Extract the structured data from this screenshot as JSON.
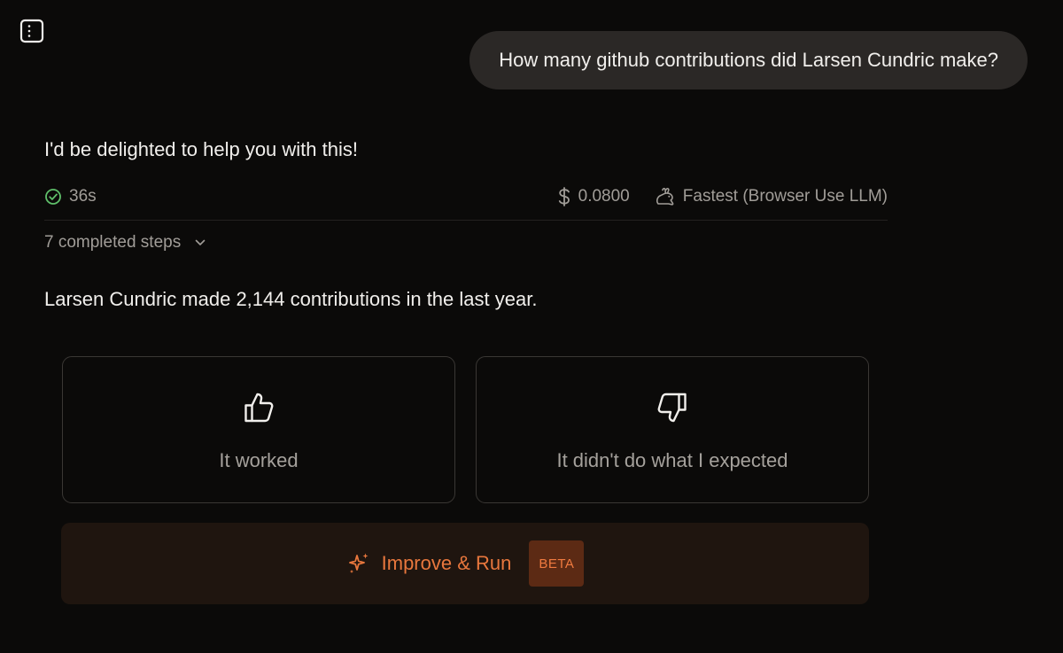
{
  "user_message": "How many github contributions did Larsen Cundric make?",
  "assistant": {
    "intro": "I'd be delighted to help you with this!",
    "duration": "36s",
    "cost": "0.0800",
    "model": "Fastest (Browser Use LLM)",
    "steps_label": "7 completed steps",
    "answer": "Larsen Cundric made 2,144 contributions in the last year."
  },
  "feedback": {
    "positive_label": "It worked",
    "negative_label": "It didn't do what I expected"
  },
  "improve": {
    "label": "Improve & Run",
    "badge": "BETA"
  },
  "icons": {
    "sidebar_toggle": "sidebar-icon",
    "status": "check-circle-icon",
    "cost": "dollar-icon",
    "model": "rabbit-icon",
    "steps": "chevron-down-icon",
    "positive": "thumbs-up-icon",
    "negative": "thumbs-down-icon",
    "improve": "sparkles-icon"
  },
  "colors": {
    "background": "#0b0a09",
    "accent": "#e8773d",
    "success": "#5fbf6a"
  }
}
